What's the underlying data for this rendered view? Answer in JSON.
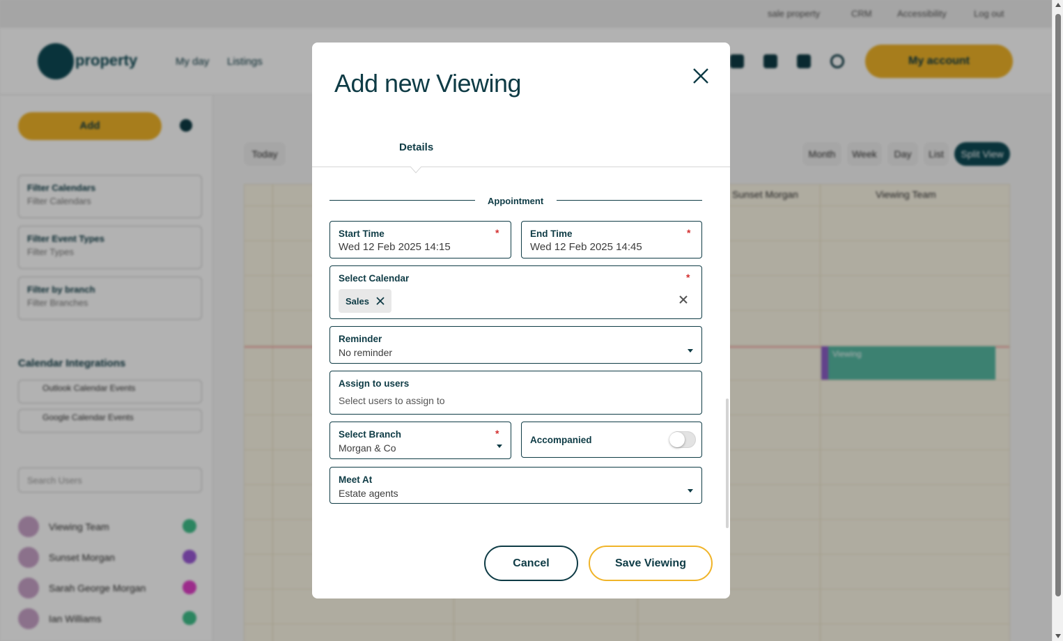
{
  "background": {
    "topbar_links": [
      "sale property",
      "CRM",
      "Accessibility",
      "Log out"
    ],
    "logo_text": "property",
    "nav_links": [
      "My day",
      "Listings"
    ],
    "my_account_label": "My account",
    "add_button_label": "Add",
    "filters": [
      {
        "label": "Filter Calendars",
        "value": "Filter Calendars"
      },
      {
        "label": "Filter Event Types",
        "value": "Filter Types"
      },
      {
        "label": "Filter by branch",
        "value": "Filter Branches"
      }
    ],
    "calendar_integrations_heading": "Calendar Integrations",
    "integrations": [
      "Outlook Calendar Events",
      "Google Calendar Events"
    ],
    "search_users_placeholder": "Search Users",
    "users": [
      {
        "name": "Viewing Team",
        "color": "#3fbf8a"
      },
      {
        "name": "Sunset Morgan",
        "color": "#9b59d6"
      },
      {
        "name": "Sarah George Morgan",
        "color": "#e040c8"
      },
      {
        "name": "Ian Williams",
        "color": "#3fbf8a"
      }
    ],
    "view_buttons": [
      "Month",
      "Week",
      "Day",
      "List",
      "Split View"
    ],
    "toolbar_left": [
      "Today"
    ],
    "calendar_columns": [
      "Sunset Morgan",
      "Viewing Team"
    ],
    "event_label": "Viewing"
  },
  "modal": {
    "title": "Add new Viewing",
    "tab": "Details",
    "section": "Appointment",
    "start_time": {
      "label": "Start Time",
      "value": "Wed 12 Feb 2025 14:15",
      "required": "*"
    },
    "end_time": {
      "label": "End Time",
      "value": "Wed 12 Feb 2025 14:45",
      "required": "*"
    },
    "calendar": {
      "label": "Select Calendar",
      "chip": "Sales",
      "required": "*"
    },
    "reminder": {
      "label": "Reminder",
      "value": "No reminder"
    },
    "assign": {
      "label": "Assign to users",
      "placeholder": "Select users to assign to"
    },
    "branch": {
      "label": "Select Branch",
      "value": "Morgan & Co",
      "required": "*"
    },
    "accompanied": {
      "label": "Accompanied",
      "checked": false
    },
    "meet_at": {
      "label": "Meet At",
      "value": "Estate agents"
    },
    "cancel_label": "Cancel",
    "save_label": "Save Viewing"
  }
}
